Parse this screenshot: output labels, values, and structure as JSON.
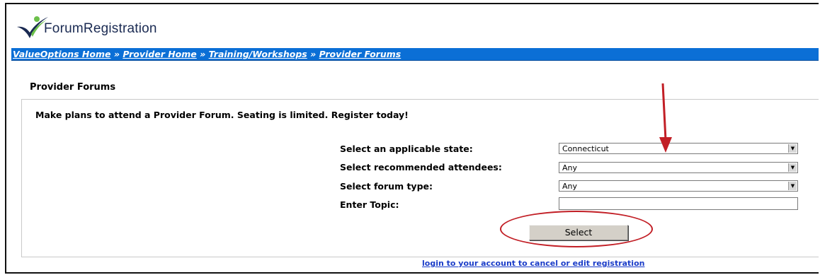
{
  "brand": {
    "name": "ForumRegistration",
    "accent": "#0b6fd6",
    "logo_icon": "swoosh-check-logo"
  },
  "breadcrumb": {
    "items": [
      "ValueOptions Home",
      "Provider Home",
      "Training/Workshops",
      "Provider Forums"
    ],
    "separator": "»"
  },
  "page": {
    "section_title": "Provider Forums",
    "intro": "Make plans to attend a Provider Forum. Seating is limited. Register today!"
  },
  "form": {
    "state_label": "Select an applicable state:",
    "state_value": "Connecticut",
    "attendees_label": "Select recommended attendees:",
    "attendees_value": "Any",
    "type_label": "Select forum type:",
    "type_value": "Any",
    "topic_label": "Enter Topic:",
    "topic_value": "",
    "submit_label": "Select"
  },
  "footer": {
    "link": "login to your account to cancel or edit registration"
  },
  "annotations": {
    "color": "#c21f26",
    "shapes": [
      "down-arrow",
      "ellipse"
    ]
  }
}
